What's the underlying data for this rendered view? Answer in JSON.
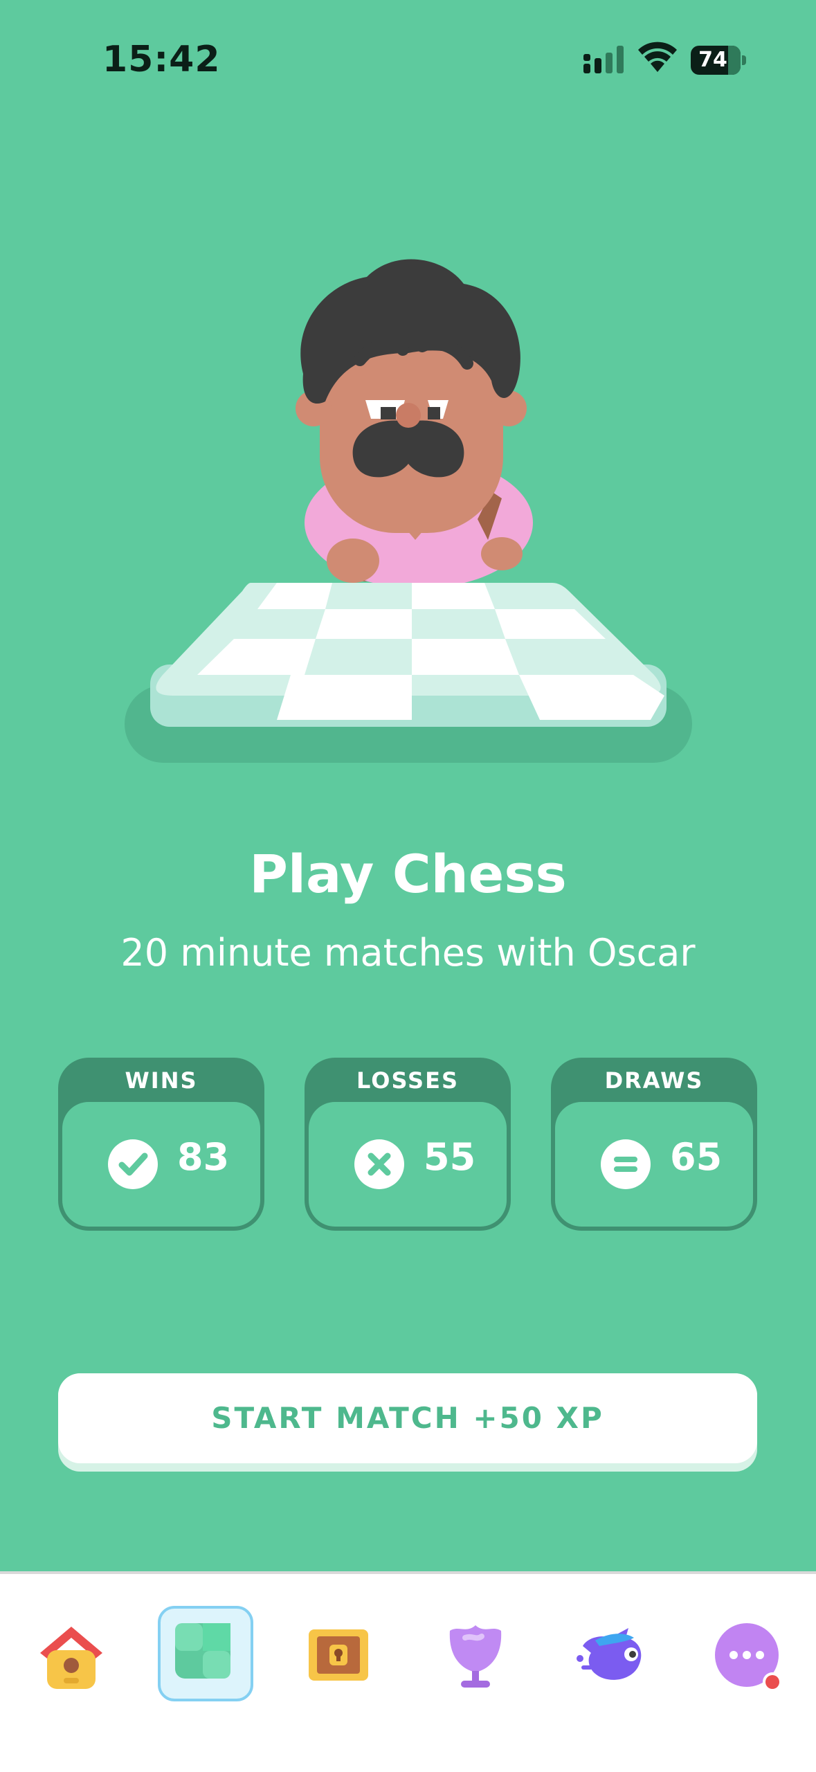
{
  "status_bar": {
    "time": "15:42",
    "battery": "74"
  },
  "hero": {
    "title": "Play Chess",
    "subtitle": "20 minute matches with Oscar"
  },
  "stats": [
    {
      "label": "WINS",
      "value": "83",
      "icon": "check-icon"
    },
    {
      "label": "LOSSES",
      "value": "55",
      "icon": "x-icon"
    },
    {
      "label": "DRAWS",
      "value": "65",
      "icon": "equals-icon"
    }
  ],
  "start_button": {
    "label": "START MATCH +50 XP"
  },
  "tabs": [
    {
      "name": "home",
      "icon": "birdhouse-icon",
      "active": false
    },
    {
      "name": "chess",
      "icon": "chessboard-icon",
      "active": true
    },
    {
      "name": "chest",
      "icon": "treasure-chest-icon",
      "active": false
    },
    {
      "name": "leagues",
      "icon": "trophy-icon",
      "active": false
    },
    {
      "name": "duo",
      "icon": "bird-icon",
      "active": false
    },
    {
      "name": "more",
      "icon": "more-icon",
      "active": false,
      "badge": true
    }
  ],
  "colors": {
    "background": "#5ECA9E",
    "stat_dark": "#3F9171",
    "accent_text": "#4EB88D",
    "active_tab_border": "#84D0F2"
  }
}
